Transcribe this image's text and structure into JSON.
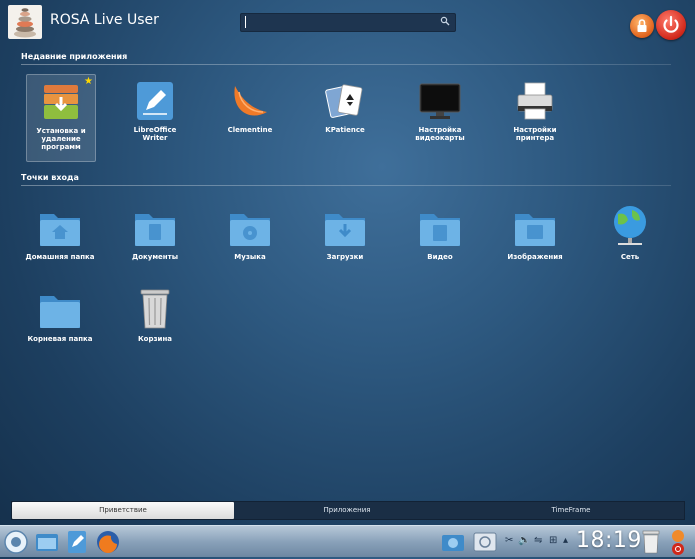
{
  "header": {
    "user_name": "ROSA Live User",
    "search_placeholder": ""
  },
  "recent": {
    "title": "Недавние приложения",
    "apps": [
      {
        "label": "Установка и удаление программ",
        "icon": "package-installer-icon",
        "favorite": true
      },
      {
        "label": "LibreOffice Writer",
        "icon": "libreoffice-writer-icon"
      },
      {
        "label": "Clementine",
        "icon": "clementine-icon"
      },
      {
        "label": "KPatience",
        "icon": "kpatience-cards-icon"
      },
      {
        "label": "Настройка видеокарты",
        "icon": "monitor-icon"
      },
      {
        "label": "Настройки принтера",
        "icon": "printer-icon"
      }
    ]
  },
  "places": {
    "title": "Точки входа",
    "items": [
      {
        "label": "Домашняя папка",
        "icon": "home-folder-icon"
      },
      {
        "label": "Документы",
        "icon": "documents-folder-icon"
      },
      {
        "label": "Музыка",
        "icon": "music-folder-icon"
      },
      {
        "label": "Загрузки",
        "icon": "downloads-folder-icon"
      },
      {
        "label": "Видео",
        "icon": "video-folder-icon"
      },
      {
        "label": "Изображения",
        "icon": "pictures-folder-icon"
      },
      {
        "label": "Сеть",
        "icon": "network-globe-icon"
      },
      {
        "label": "Корневая папка",
        "icon": "root-folder-icon"
      },
      {
        "label": "Корзина",
        "icon": "trash-icon"
      }
    ]
  },
  "tabs": [
    {
      "label": "Приветствие",
      "active": true
    },
    {
      "label": "Приложения",
      "active": false
    },
    {
      "label": "TimeFrame",
      "active": false
    }
  ],
  "taskbar": {
    "clock": "18:19"
  },
  "colors": {
    "background": "#2d587f",
    "power": "#d1281a",
    "lock": "#e0621c",
    "folder": "#5aa5dc"
  }
}
